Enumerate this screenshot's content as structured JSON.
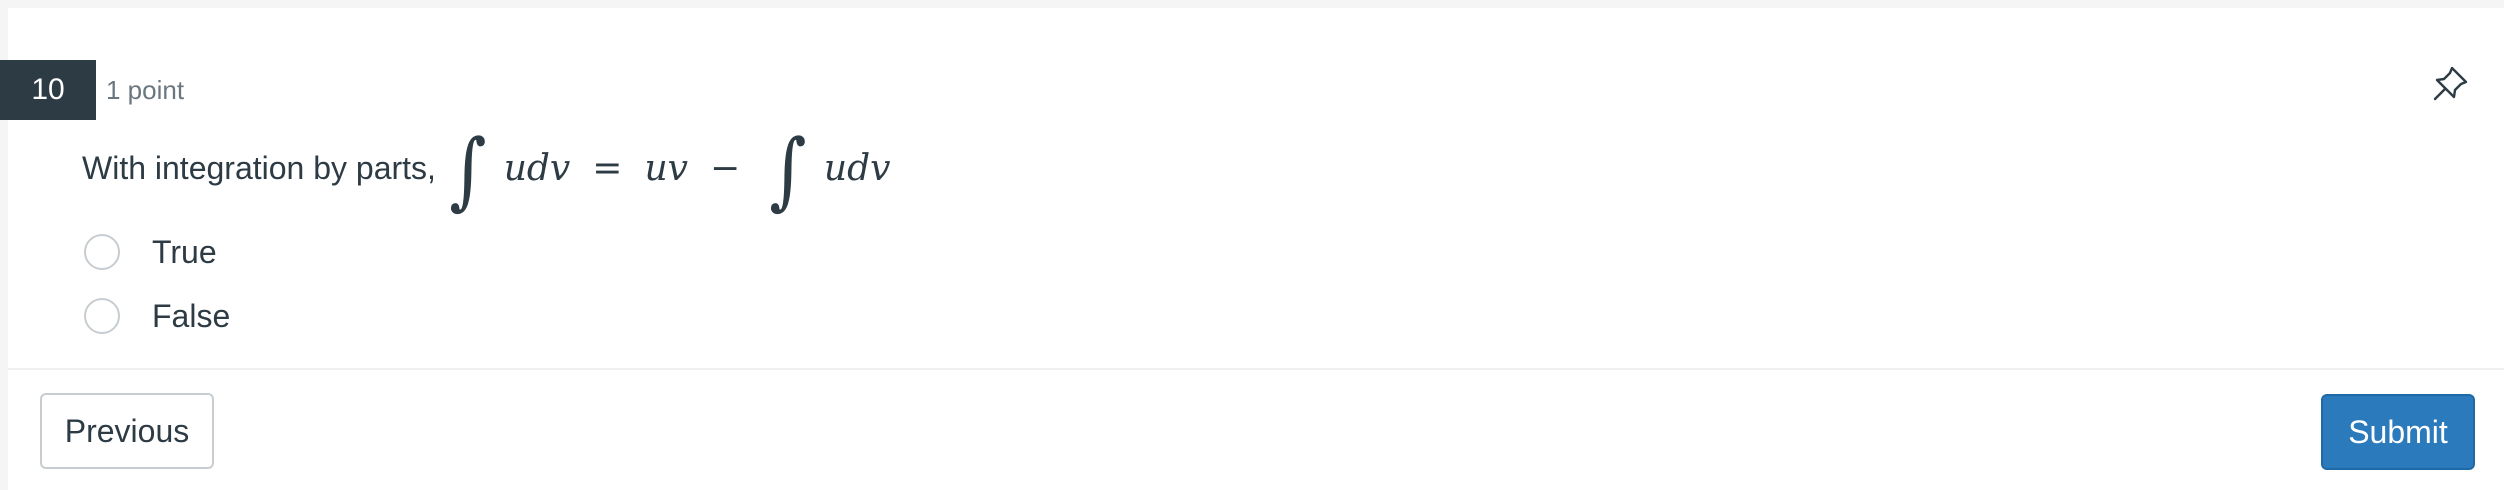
{
  "question": {
    "number": "10",
    "points": "1 point",
    "prompt_text": "With integration by parts,",
    "math": {
      "integral_1": "∫",
      "left_vars": "udv",
      "equals": "=",
      "middle_vars": "uv",
      "minus": "−",
      "integral_2": "∫",
      "right_vars": "udv"
    },
    "options": [
      {
        "label": "True",
        "selected": false
      },
      {
        "label": "False",
        "selected": false
      }
    ]
  },
  "icons": {
    "pin": "pin-icon"
  },
  "footer": {
    "previous_label": "Previous",
    "submit_label": "Submit"
  },
  "colors": {
    "question_number_bg": "#2d3b45",
    "submit_bg": "#2b7abc",
    "text": "#2d3b45",
    "muted_text": "#6b7780"
  }
}
